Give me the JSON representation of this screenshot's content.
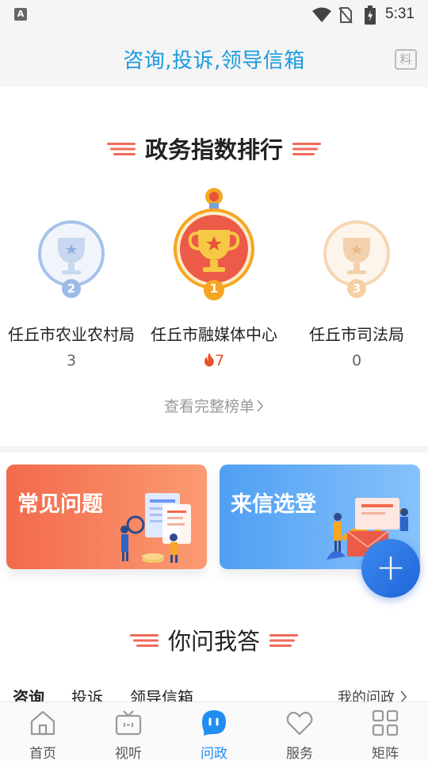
{
  "status_bar": {
    "notification_glyph": "A",
    "time": "5:31",
    "icons": [
      "wifi-icon",
      "no-sim-icon",
      "battery-charging-icon"
    ]
  },
  "header": {
    "title": "咨询,投诉,领导信箱",
    "action_icon_text": "料"
  },
  "ranking": {
    "title": "政务指数排行",
    "items": [
      {
        "rank": "2",
        "name": "任丘市农业农村局",
        "score": "3",
        "hot": false
      },
      {
        "rank": "1",
        "name": "任丘市融媒体中心",
        "score": "7",
        "hot": true
      },
      {
        "rank": "3",
        "name": "任丘市司法局",
        "score": "0",
        "hot": false
      }
    ],
    "see_all": "查看完整榜单"
  },
  "cards": [
    {
      "title": "常见问题"
    },
    {
      "title": "来信选登"
    }
  ],
  "fab": {
    "label": "+"
  },
  "qa": {
    "title": "你问我答",
    "tabs": [
      "咨询",
      "投诉",
      "领导信箱"
    ],
    "my_questions": "我的问政"
  },
  "bottom_nav": [
    {
      "label": "首页",
      "icon": "home-icon"
    },
    {
      "label": "视听",
      "icon": "tv-icon"
    },
    {
      "label": "问政",
      "icon": "chat-icon",
      "active": true
    },
    {
      "label": "服务",
      "icon": "heart-icon"
    },
    {
      "label": "矩阵",
      "icon": "grid-icon"
    }
  ],
  "colors": {
    "accent_blue": "#1a9be0",
    "nav_active": "#1f8ef0",
    "gold": "#f5a623",
    "hot": "#e5532b",
    "card_orange": "#f26a4c",
    "card_blue": "#4f9ff3"
  }
}
